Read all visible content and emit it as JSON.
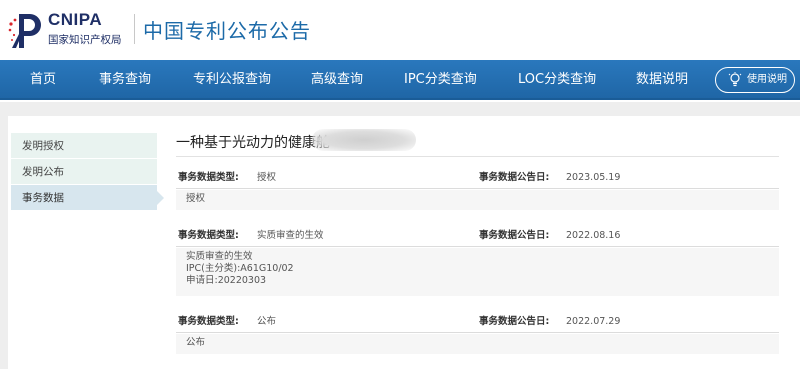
{
  "logo": {
    "abbr": "CNIPA",
    "org_name": "国家知识产权局"
  },
  "site_title": "中国专利公布公告",
  "nav": {
    "items": [
      "首页",
      "事务查询",
      "专利公报查询",
      "高级查询",
      "IPC分类查询",
      "LOC分类查询",
      "数据说明"
    ],
    "help_label": "使用说明"
  },
  "sidebar": {
    "items": [
      {
        "label": "发明授权",
        "active": false
      },
      {
        "label": "发明公布",
        "active": false
      },
      {
        "label": "事务数据",
        "active": true
      }
    ]
  },
  "detail": {
    "title": "一种基于光动力的健康舱",
    "type_label": "事务数据类型:",
    "date_label": "事务数据公告日:",
    "records": [
      {
        "type": "授权",
        "date": "2023.05.19",
        "body": [
          "授权"
        ]
      },
      {
        "type": "实质审查的生效",
        "date": "2022.08.16",
        "body": [
          "实质审查的生效",
          "IPC(主分类):A61G10/02",
          "申请日:20220303"
        ]
      },
      {
        "type": "公布",
        "date": "2022.07.29",
        "body": [
          "公布"
        ]
      }
    ]
  },
  "colors": {
    "nav_bg": "#2a78bd",
    "title_blue": "#1c6aa8",
    "logo_navy": "#1f2f66",
    "logo_red": "#d9262c"
  }
}
